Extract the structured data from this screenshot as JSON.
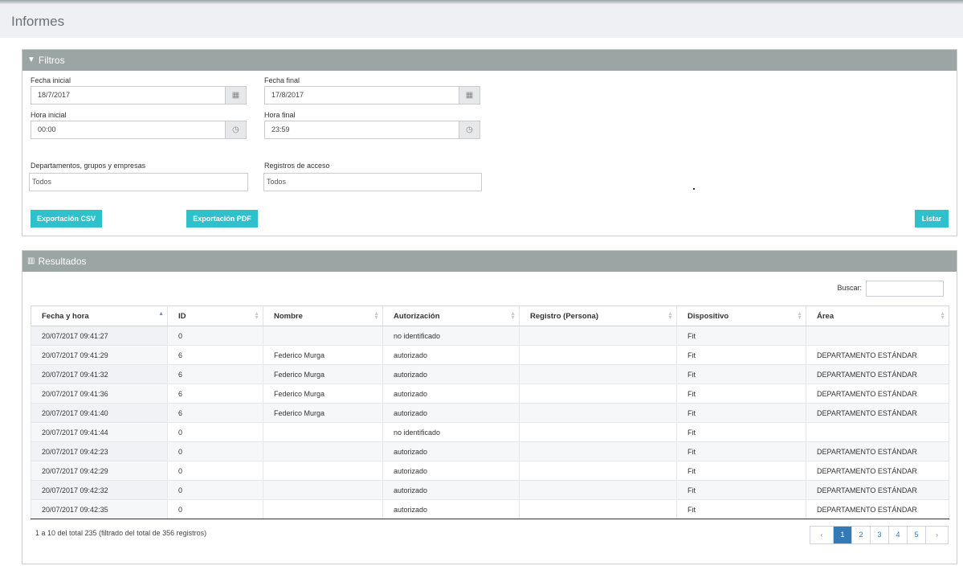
{
  "page": {
    "title": "Informes"
  },
  "filters": {
    "title": "Filtros",
    "icon": "filter-icon",
    "fecha_inicial": {
      "label": "Fecha inicial",
      "value": "18/7/2017",
      "icon": "calendar-icon"
    },
    "fecha_final": {
      "label": "Fecha final",
      "value": "17/8/2017",
      "icon": "calendar-icon"
    },
    "hora_inicial": {
      "label": "Hora inicial",
      "value": "00:00",
      "icon": "clock-icon"
    },
    "hora_final": {
      "label": "Hora final",
      "value": "23:59",
      "icon": "clock-icon"
    },
    "departamentos": {
      "label": "Departamentos, grupos y empresas",
      "value": "Todos"
    },
    "registros": {
      "label": "Registros de acceso",
      "value": "Todos"
    },
    "export_csv": "Exportación CSV",
    "export_pdf": "Exportación PDF",
    "listar": "Listar",
    "accent_color": "#2ec1cc",
    "header_color": "#9ba5a4"
  },
  "results": {
    "title": "Resultados",
    "icon": "bar-chart-icon",
    "search_label": "Buscar:",
    "search_value": "",
    "columns": [
      "Fecha y hora",
      "ID",
      "Nombre",
      "Autorización",
      "Registro (Persona)",
      "Dispositivo",
      "Área"
    ],
    "rows": [
      {
        "fecha": "20/07/2017 09:41:27",
        "id": "0",
        "nombre": "",
        "autorizacion": "no identificado",
        "registro": "",
        "dispositivo": "Fit",
        "area": ""
      },
      {
        "fecha": "20/07/2017 09:41:29",
        "id": "6",
        "nombre": "Federico Murga",
        "autorizacion": "autorizado",
        "registro": "",
        "dispositivo": "Fit",
        "area": "DEPARTAMENTO ESTÁNDAR"
      },
      {
        "fecha": "20/07/2017 09:41:32",
        "id": "6",
        "nombre": "Federico Murga",
        "autorizacion": "autorizado",
        "registro": "",
        "dispositivo": "Fit",
        "area": "DEPARTAMENTO ESTÁNDAR"
      },
      {
        "fecha": "20/07/2017 09:41:36",
        "id": "6",
        "nombre": "Federico Murga",
        "autorizacion": "autorizado",
        "registro": "",
        "dispositivo": "Fit",
        "area": "DEPARTAMENTO ESTÁNDAR"
      },
      {
        "fecha": "20/07/2017 09:41:40",
        "id": "6",
        "nombre": "Federico Murga",
        "autorizacion": "autorizado",
        "registro": "",
        "dispositivo": "Fit",
        "area": "DEPARTAMENTO ESTÁNDAR"
      },
      {
        "fecha": "20/07/2017 09:41:44",
        "id": "0",
        "nombre": "",
        "autorizacion": "no identificado",
        "registro": "",
        "dispositivo": "Fit",
        "area": ""
      },
      {
        "fecha": "20/07/2017 09:42:23",
        "id": "0",
        "nombre": "",
        "autorizacion": "autorizado",
        "registro": "",
        "dispositivo": "Fit",
        "area": "DEPARTAMENTO ESTÁNDAR"
      },
      {
        "fecha": "20/07/2017 09:42:29",
        "id": "0",
        "nombre": "",
        "autorizacion": "autorizado",
        "registro": "",
        "dispositivo": "Fit",
        "area": "DEPARTAMENTO ESTÁNDAR"
      },
      {
        "fecha": "20/07/2017 09:42:32",
        "id": "0",
        "nombre": "",
        "autorizacion": "autorizado",
        "registro": "",
        "dispositivo": "Fit",
        "area": "DEPARTAMENTO ESTÁNDAR"
      },
      {
        "fecha": "20/07/2017 09:42:35",
        "id": "0",
        "nombre": "",
        "autorizacion": "autorizado",
        "registro": "",
        "dispositivo": "Fit",
        "area": "DEPARTAMENTO ESTÁNDAR"
      }
    ],
    "info": "1 a 10 del total 235 (filtrado del total de 356 registros)",
    "pagination": {
      "prev": "‹",
      "pages": [
        "1",
        "2",
        "3",
        "4",
        "5"
      ],
      "active": "1",
      "next": "›"
    },
    "status_colors": {
      "no identificado": "#d11f1f",
      "autorizado": "#2e8c2e"
    }
  }
}
